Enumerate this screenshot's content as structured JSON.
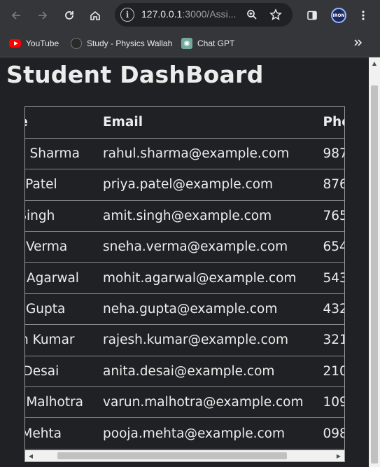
{
  "browser": {
    "url_host": "127.0.0.1",
    "url_path": ":3000/Assi...",
    "bookmarks": [
      {
        "label": "YouTube",
        "icon": "youtube-icon"
      },
      {
        "label": "Study - Physics Wallah",
        "icon": "physics-wallah-icon"
      },
      {
        "label": "Chat GPT",
        "icon": "chatgpt-icon"
      }
    ],
    "avatar_text": "IRON"
  },
  "page": {
    "title": "Student DashBoard"
  },
  "table": {
    "columns": [
      "me",
      "Email",
      "Pho"
    ],
    "rows": [
      {
        "name": "hul Sharma",
        "email": "rahul.sharma@example.com",
        "phone": "987"
      },
      {
        "name": "ya Patel",
        "email": "priya.patel@example.com",
        "phone": "876"
      },
      {
        "name": "it Singh",
        "email": "amit.singh@example.com",
        "phone": "765"
      },
      {
        "name": "ha Verma",
        "email": "sneha.verma@example.com",
        "phone": "654"
      },
      {
        "name": "hit Agarwal",
        "email": "mohit.agarwal@example.com",
        "phone": "543"
      },
      {
        "name": "ha Gupta",
        "email": "neha.gupta@example.com",
        "phone": "432"
      },
      {
        "name": "esh Kumar",
        "email": "rajesh.kumar@example.com",
        "phone": "321"
      },
      {
        "name": "ta Desai",
        "email": "anita.desai@example.com",
        "phone": "210"
      },
      {
        "name": "un Malhotra",
        "email": "varun.malhotra@example.com",
        "phone": "109"
      },
      {
        "name": "ja Mehta",
        "email": "pooja.mehta@example.com",
        "phone": "098"
      }
    ]
  },
  "colors": {
    "page_bg": "#202124",
    "text": "#ececec",
    "chrome_bg": "#35363a",
    "border": "#9a9a9a"
  }
}
